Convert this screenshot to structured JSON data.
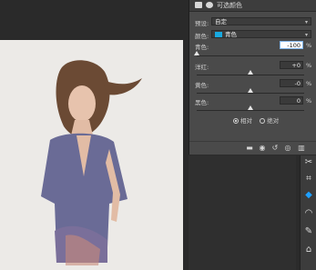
{
  "panel": {
    "title": "可选颜色",
    "preset_label": "预设:",
    "preset_value": "自定",
    "colors_label": "颜色:",
    "colors_value": "青色",
    "colors_swatch": "#18a9e0"
  },
  "sliders": [
    {
      "label": "青色:",
      "value": "-100",
      "unit": "%",
      "position": 0.0
    },
    {
      "label": "洋红:",
      "value": "+0",
      "unit": "%",
      "position": 0.5
    },
    {
      "label": "黄色:",
      "value": "-0",
      "unit": "%",
      "position": 0.5
    },
    {
      "label": "黑色:",
      "value": "0",
      "unit": "%",
      "position": 0.5
    }
  ],
  "method": {
    "relative_label": "相对",
    "absolute_label": "绝对",
    "selected": "relative"
  },
  "colors": {
    "panel_bg": "#4a4a4a",
    "accent": "#1ea0ff"
  }
}
